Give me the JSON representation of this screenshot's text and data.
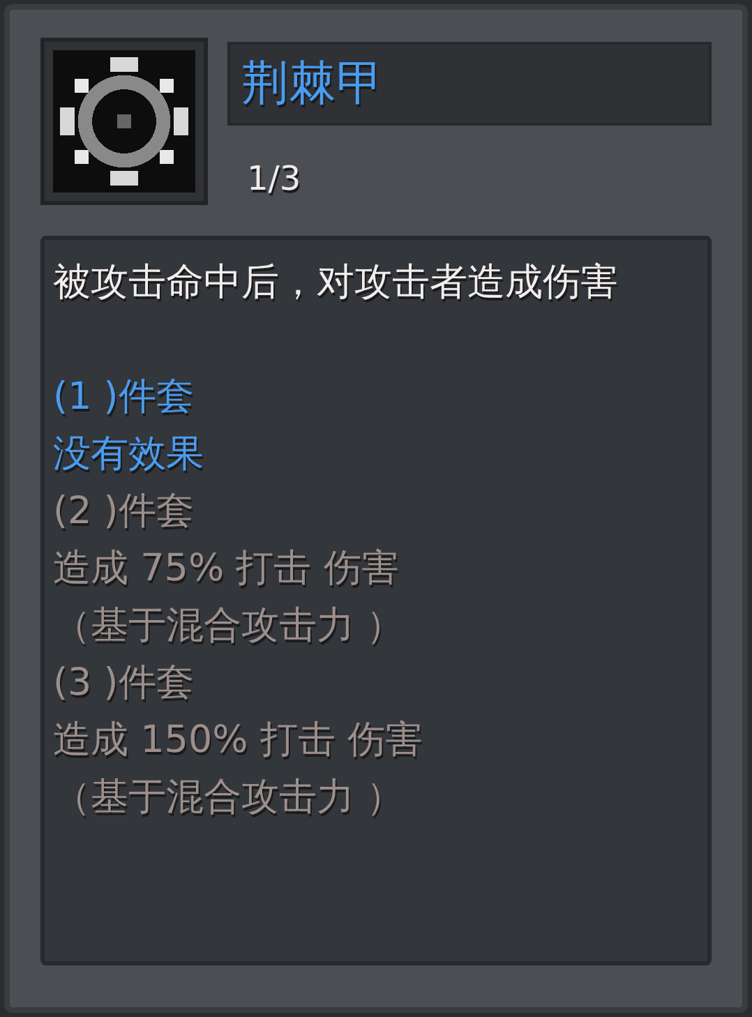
{
  "item": {
    "name": "荆棘甲",
    "count": "1/3"
  },
  "description": "被攻击命中后，对攻击者造成伤害",
  "set_bonuses": [
    {
      "label": "(1 )件套",
      "active": true,
      "effects": [
        "没有效果"
      ]
    },
    {
      "label": "(2 )件套",
      "active": false,
      "effects": [
        "造成 75% 打击 伤害",
        "（基于混合攻击力 ）"
      ]
    },
    {
      "label": "(3 )件套",
      "active": false,
      "effects": [
        "造成 150% 打击 伤害",
        "（基于混合攻击力 ）"
      ]
    }
  ]
}
